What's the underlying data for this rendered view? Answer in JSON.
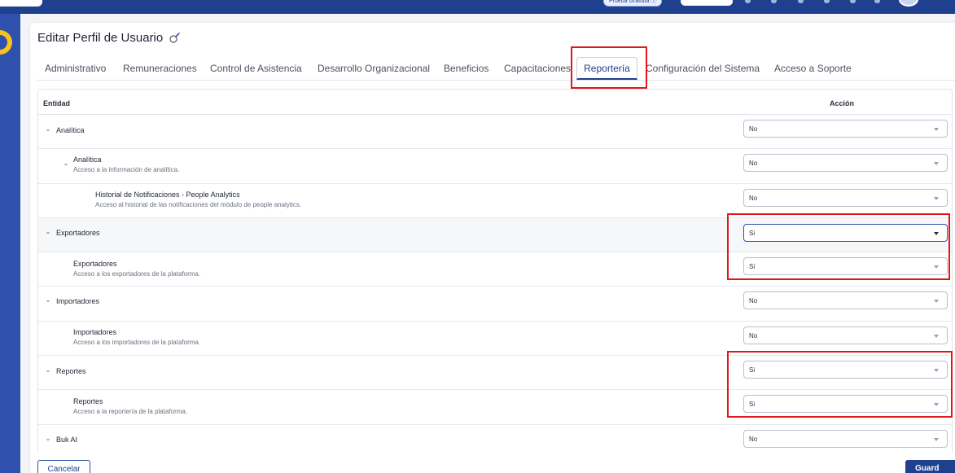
{
  "header": {
    "trial_label": "Prueba Gratuita ⓘ"
  },
  "page": {
    "title": "Editar Perfil de Usuario",
    "edit_icon": "edit-pencil-icon"
  },
  "tabs": [
    {
      "label": "Administrativo"
    },
    {
      "label": "Remuneraciones"
    },
    {
      "label": "Control de Asistencia"
    },
    {
      "label": "Desarrollo Organizacional"
    },
    {
      "label": "Beneficios"
    },
    {
      "label": "Capacitaciones"
    },
    {
      "label": "Reportería",
      "active": true
    },
    {
      "label": "Configuración del Sistema"
    },
    {
      "label": "Acceso a Soporte"
    }
  ],
  "table": {
    "col_entity": "Entidad",
    "col_action": "Acción",
    "rows": [
      {
        "label": "Analítica",
        "description": "",
        "value": "No",
        "level": 0,
        "expandable": true
      },
      {
        "label": "Analítica",
        "description": "Acceso a la información de analítica.",
        "value": "No",
        "level": 1,
        "expandable": true
      },
      {
        "label": "Historial de Notificaciones - People Analytics",
        "description": "Acceso al historial de las notificaciones del módulo de people analytics.",
        "value": "No",
        "level": 2,
        "expandable": false
      },
      {
        "label": "Exportadores",
        "description": "",
        "value": "Si",
        "level": 0,
        "expandable": true,
        "focused": true
      },
      {
        "label": "Exportadores",
        "description": "Acceso a los exportadores de la plataforma.",
        "value": "Si",
        "level": 1,
        "expandable": false
      },
      {
        "label": "Importadores",
        "description": "",
        "value": "No",
        "level": 0,
        "expandable": true
      },
      {
        "label": "Importadores",
        "description": "Acceso a los importadores de la plataforma.",
        "value": "No",
        "level": 1,
        "expandable": false
      },
      {
        "label": "Reportes",
        "description": "",
        "value": "Si",
        "level": 0,
        "expandable": true
      },
      {
        "label": "Reportes",
        "description": "Acceso a la reportería de la plataforma.",
        "value": "Si",
        "level": 1,
        "expandable": false
      },
      {
        "label": "Buk AI",
        "description": "",
        "value": "No",
        "level": 0,
        "expandable": true
      }
    ]
  },
  "footer": {
    "cancel_label": "Cancelar",
    "save_label": "Guard"
  },
  "colors": {
    "brand": "#1f3f8f",
    "sidebar": "#2f50ac",
    "highlight_box": "#e0161c",
    "logo": "#f7c21e"
  }
}
